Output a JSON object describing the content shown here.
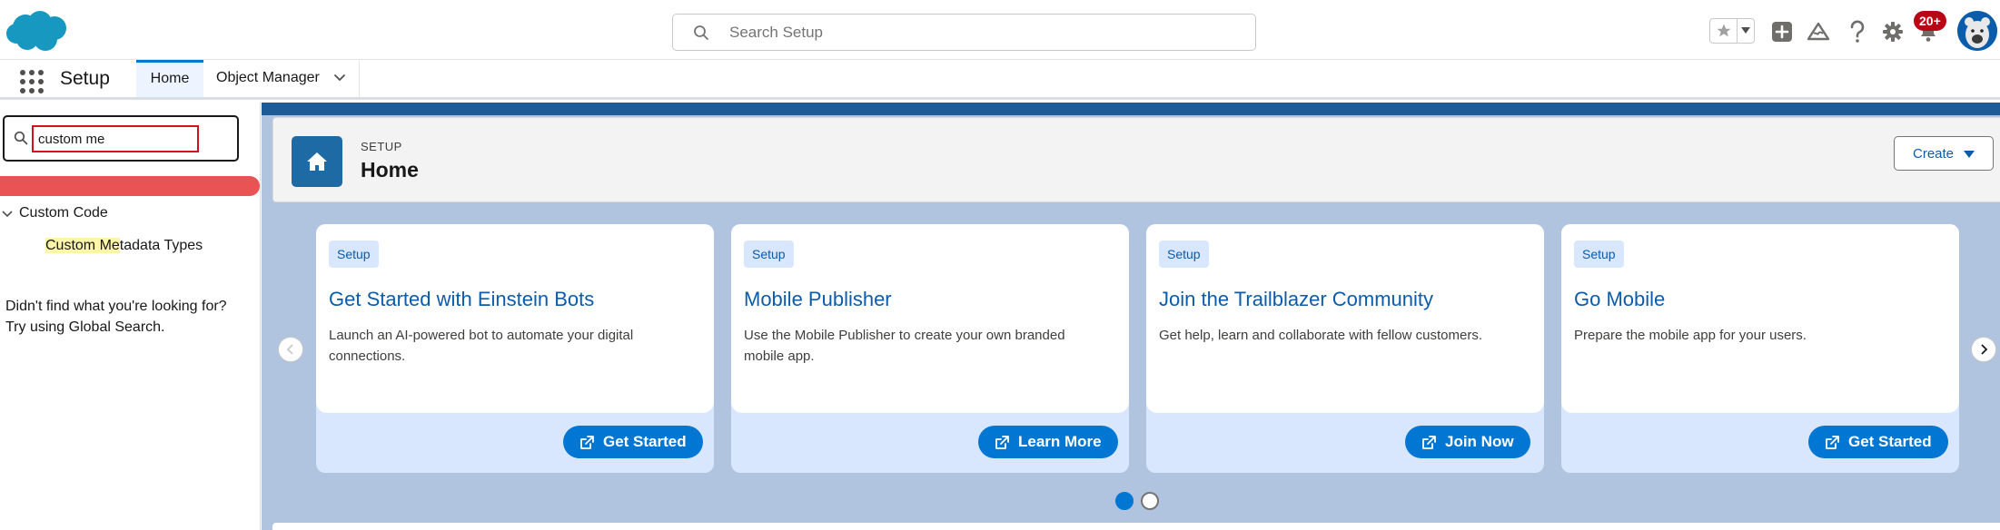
{
  "header": {
    "search_placeholder": "Search Setup",
    "notification_count": "20+",
    "colors": {
      "brand": "#0176d3",
      "cloud": "#1798c1",
      "badge": "#ba0517"
    }
  },
  "nav": {
    "app_name": "Setup",
    "tabs": [
      {
        "label": "Home"
      },
      {
        "label": "Object Manager"
      }
    ]
  },
  "sidebar": {
    "quick_find_value": "custom me",
    "tree": {
      "group_label": "Custom Code",
      "item_highlight": "Custom Me",
      "item_rest": "tadata Types"
    },
    "not_found_line1": "Didn't find what you're looking for?",
    "not_found_line2": "Try using Global Search."
  },
  "page_header": {
    "eyebrow": "SETUP",
    "title": "Home",
    "create_label": "Create"
  },
  "cards": [
    {
      "badge": "Setup",
      "title": "Get Started with Einstein Bots",
      "desc": "Launch an AI-powered bot to automate your digital connections.",
      "button": "Get Started"
    },
    {
      "badge": "Setup",
      "title": "Mobile Publisher",
      "desc": "Use the Mobile Publisher to create your own branded mobile app.",
      "button": "Learn More"
    },
    {
      "badge": "Setup",
      "title": "Join the Trailblazer Community",
      "desc": "Get help, learn and collaborate with fellow customers.",
      "button": "Join Now"
    },
    {
      "badge": "Setup",
      "title": "Go Mobile",
      "desc": "Prepare the mobile app for your users.",
      "button": "Get Started"
    }
  ]
}
